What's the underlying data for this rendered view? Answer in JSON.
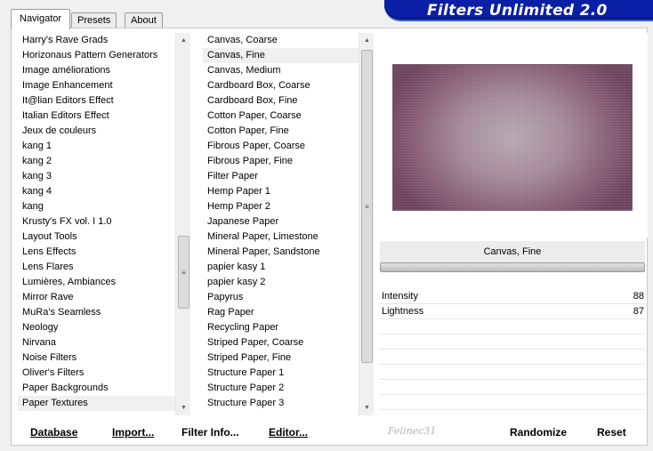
{
  "tabs": [
    {
      "label": "Navigator",
      "active": true
    },
    {
      "label": "Presets",
      "active": false
    },
    {
      "label": "About",
      "active": false
    }
  ],
  "app_title": "Filters Unlimited 2.0",
  "categories": {
    "items": [
      "Harry's Rave Grads",
      "Horizonaus Pattern Generators",
      "Image améliorations",
      "Image Enhancement",
      "It@lian Editors Effect",
      "Italian Editors Effect",
      "Jeux de couleurs",
      "kang 1",
      "kang 2",
      "kang 3",
      "kang 4",
      "kang",
      "Krusty's FX vol. I 1.0",
      "Layout Tools",
      "Lens Effects",
      "Lens Flares",
      "Lumières, Ambiances",
      "Mirror Rave",
      "MuRa's Seamless",
      "Neology",
      "Nirvana",
      "Noise Filters",
      "Oliver's Filters",
      "Paper Backgrounds",
      "Paper Textures"
    ],
    "selected": "Paper Textures"
  },
  "filters": {
    "items": [
      "Canvas, Coarse",
      "Canvas, Fine",
      "Canvas, Medium",
      "Cardboard Box, Coarse",
      "Cardboard Box, Fine",
      "Cotton Paper, Coarse",
      "Cotton Paper, Fine",
      "Fibrous Paper, Coarse",
      "Fibrous Paper, Fine",
      "Filter Paper",
      "Hemp Paper 1",
      "Hemp Paper 2",
      "Japanese Paper",
      "Mineral Paper, Limestone",
      "Mineral Paper, Sandstone",
      "papier kasy 1",
      "papier kasy 2",
      "Papyrus",
      "Rag Paper",
      "Recycling Paper",
      "Striped Paper, Coarse",
      "Striped Paper, Fine",
      "Structure Paper 1",
      "Structure Paper 2",
      "Structure Paper 3"
    ],
    "selected": "Canvas, Fine"
  },
  "current_filter": "Canvas, Fine",
  "parameters": [
    {
      "label": "Intensity",
      "value": "88"
    },
    {
      "label": "Lightness",
      "value": "87"
    }
  ],
  "buttons": {
    "database": "Database",
    "import": "Import...",
    "filter_info": "Filter Info...",
    "editor": "Editor...",
    "randomize": "Randomize",
    "reset": "Reset"
  },
  "signature_text": "Felinec31",
  "icons": {
    "scroll_up": "triangle-up-icon",
    "scroll_down": "triangle-down-icon",
    "thumb_grip": "grip-icon"
  },
  "colors": {
    "banner": "#0a1ea6",
    "selection": "#f0f0f0"
  }
}
